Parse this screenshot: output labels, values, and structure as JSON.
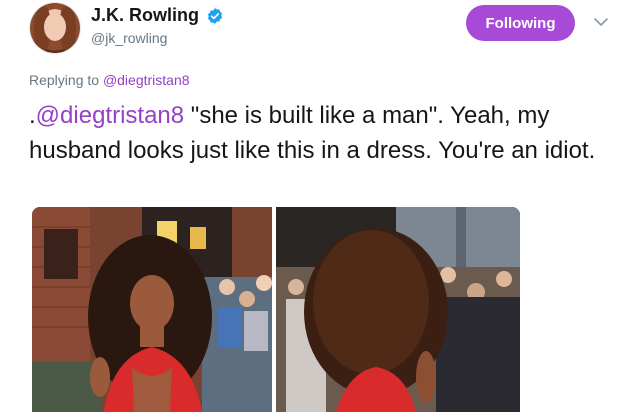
{
  "tweet": {
    "author": {
      "name": "J.K. Rowling",
      "handle": "@jk_rowling",
      "verified": true
    },
    "follow_button": {
      "label": "Following"
    },
    "replying_to": {
      "prefix": "Replying to",
      "mention": "@diegtristan8"
    },
    "text": {
      "prefix": ".",
      "mention": "@diegtristan8",
      "body": " \"she is built like a man\". Yeah, my husband looks just like this in a dress. You're an idiot."
    },
    "media": [
      {
        "kind": "photo",
        "icon": "photo-left"
      },
      {
        "kind": "photo",
        "icon": "photo-right"
      }
    ]
  },
  "colors": {
    "accent": "#a84ad8",
    "mention": "#9440c8",
    "verified": "#1da1f2",
    "muted": "#657786",
    "text": "#14171a"
  }
}
